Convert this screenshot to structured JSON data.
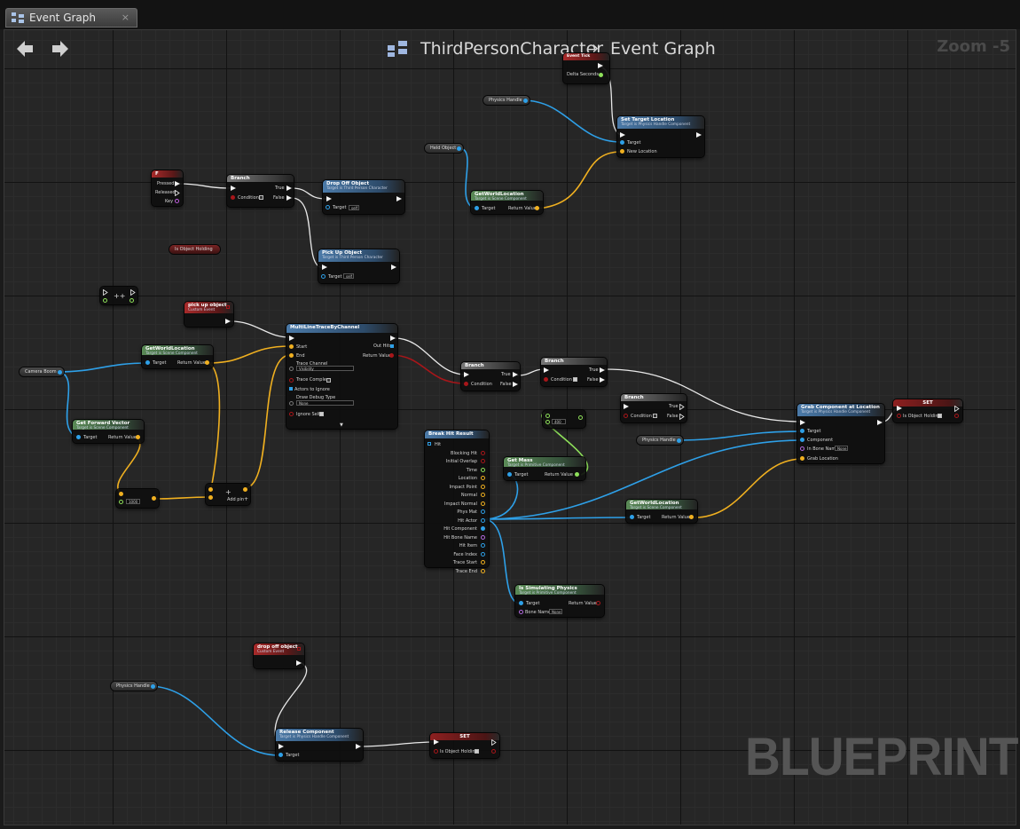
{
  "tab": {
    "label": "Event Graph",
    "close": "×"
  },
  "breadcrumb": {
    "owner": "ThirdPersonCharacter",
    "separator": "›",
    "graph": "Event Graph"
  },
  "zoom": "Zoom -5",
  "watermark": "BLUEPRINT",
  "nodes": {
    "event_tick": {
      "title": "Event Tick",
      "out": "Delta Seconds"
    },
    "physics_handle_1": {
      "label": "Physics Handle"
    },
    "set_target_location": {
      "title": "Set Target Location",
      "subtitle": "Target is Physics Handle Component",
      "pins": [
        "Target",
        "New Location"
      ]
    },
    "held_object": {
      "label": "Held Object"
    },
    "get_world_location_1": {
      "title": "GetWorldLocation",
      "subtitle": "Target is Scene Component",
      "pins": [
        "Target",
        "Return Value"
      ]
    },
    "f_key": {
      "title": "F",
      "pins": [
        "Pressed",
        "Released",
        "Key"
      ]
    },
    "branch_1": {
      "title": "Branch",
      "pins": [
        "Condition",
        "True",
        "False"
      ]
    },
    "drop_off_object": {
      "title": "Drop Off Object",
      "subtitle": "Target is Third Person Character",
      "pins": [
        "Target"
      ],
      "value": "self"
    },
    "pick_up_object": {
      "title": "Pick Up Object",
      "subtitle": "Target is Third Person Character",
      "pins": [
        "Target"
      ],
      "value": "self"
    },
    "is_object_holding_get": {
      "label": "Is Object Holding"
    },
    "flipflop": {
      "label": "++"
    },
    "pick_up_event": {
      "title": "pick up object",
      "subtitle": "Custom Event"
    },
    "multi_line_trace": {
      "title": "MultiLineTraceByChannel",
      "pins": [
        "Start",
        "End",
        "Trace Channel",
        "Trace Complex",
        "Actors to Ignore",
        "Draw Debug Type",
        "Ignore Self",
        "Out Hits",
        "Return Value"
      ],
      "trace_channel": "Visibility",
      "draw_debug": "None"
    },
    "camera_boom": {
      "label": "Camera Boom"
    },
    "get_world_location_2": {
      "title": "GetWorldLocation",
      "subtitle": "Target is Scene Component",
      "pins": [
        "Target",
        "Return Value"
      ]
    },
    "get_forward_vector": {
      "title": "Get Forward Vector",
      "subtitle": "Target is Scene Component",
      "pins": [
        "Target",
        "Return Value"
      ]
    },
    "multiply": {
      "value": "1000"
    },
    "add": {
      "label": "+",
      "addpin": "Add pin"
    },
    "branch_2": {
      "title": "Branch",
      "pins": [
        "Condition",
        "True",
        "False"
      ]
    },
    "branch_3": {
      "title": "Branch",
      "pins": [
        "Condition",
        "True",
        "False"
      ]
    },
    "branch_4": {
      "title": "Branch",
      "pins": [
        "Condition",
        "True",
        "False"
      ]
    },
    "break_hit_result": {
      "title": "Break Hit Result",
      "pins": [
        "Hit",
        "Blocking Hit",
        "Initial Overlap",
        "Time",
        "Location",
        "Impact Point",
        "Normal",
        "Impact Normal",
        "Phys Mat",
        "Hit Actor",
        "Hit Component",
        "Hit Bone Name",
        "Hit Item",
        "Face Index",
        "Trace Start",
        "Trace End"
      ]
    },
    "compare": {
      "value": "400"
    },
    "get_mass": {
      "title": "Get Mass",
      "subtitle": "Target is Primitive Component",
      "pins": [
        "Target",
        "Return Value"
      ]
    },
    "grab_component": {
      "title": "Grab Component at Location",
      "subtitle": "Target is Physics Handle Component",
      "pins": [
        "Target",
        "Component",
        "In Bone Name",
        "Grab Location"
      ],
      "bone": "None"
    },
    "physics_handle_2": {
      "label": "Physics Handle"
    },
    "set_holding_1": {
      "title": "SET",
      "pins": [
        "Is Object Holding"
      ]
    },
    "get_world_location_3": {
      "title": "GetWorldLocation",
      "subtitle": "Target is Scene Component",
      "pins": [
        "Target",
        "Return Value"
      ]
    },
    "is_simulating": {
      "title": "Is Simulating Physics",
      "subtitle": "Target is Primitive Component",
      "pins": [
        "Target",
        "Bone Name",
        "Return Value"
      ],
      "bone": "None"
    },
    "drop_off_event": {
      "title": "drop off object",
      "subtitle": "Custom Event"
    },
    "physics_handle_3": {
      "label": "Physics Handle"
    },
    "release_component": {
      "title": "Release Component",
      "subtitle": "Target is Physics Handle Component",
      "pins": [
        "Target"
      ]
    },
    "set_holding_2": {
      "title": "SET",
      "pins": [
        "Is Object Holding"
      ]
    }
  },
  "colors": {
    "exec": "#f2f2f2",
    "object": "#2ea0e8",
    "vector": "#f0b020",
    "bool": "#a8161a",
    "float": "#8ee05a"
  }
}
